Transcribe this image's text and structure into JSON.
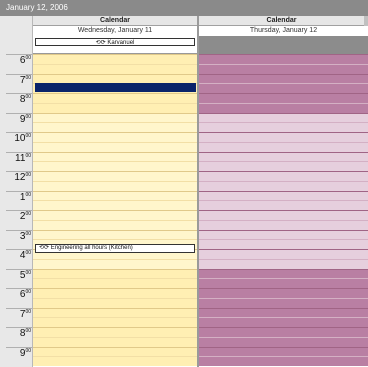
{
  "window": {
    "date_title": "January 12, 2006"
  },
  "columns": [
    {
      "header": "Calendar",
      "date": "Wednesday, January 11"
    },
    {
      "header": "Calendar",
      "date": "Thursday, January 12"
    }
  ],
  "all_day_event": {
    "label": "Karvanuel"
  },
  "appointment": {
    "label": "Engineering all hours (Kitchen)"
  },
  "hours": [
    {
      "h": "6",
      "m": "00"
    },
    {
      "h": "7",
      "m": "00"
    },
    {
      "h": "8",
      "m": "00"
    },
    {
      "h": "9",
      "m": "00"
    },
    {
      "h": "10",
      "m": "00"
    },
    {
      "h": "11",
      "m": "00"
    },
    {
      "h": "12",
      "m": "00"
    },
    {
      "h": "1",
      "m": "00"
    },
    {
      "h": "2",
      "m": "00"
    },
    {
      "h": "3",
      "m": "00"
    },
    {
      "h": "4",
      "m": "00"
    },
    {
      "h": "5",
      "m": "00"
    },
    {
      "h": "6",
      "m": "00"
    },
    {
      "h": "7",
      "m": "00"
    },
    {
      "h": "8",
      "m": "00"
    },
    {
      "h": "9",
      "m": "00"
    }
  ],
  "icons": {
    "appointment": "recurring-icon"
  },
  "colors": {
    "left_work": "#fff6cc",
    "left_offhours": "#ffefb3",
    "right_work": "#e6cfdd",
    "right_offhours": "#b97fa3",
    "selection": "#0a246a"
  }
}
